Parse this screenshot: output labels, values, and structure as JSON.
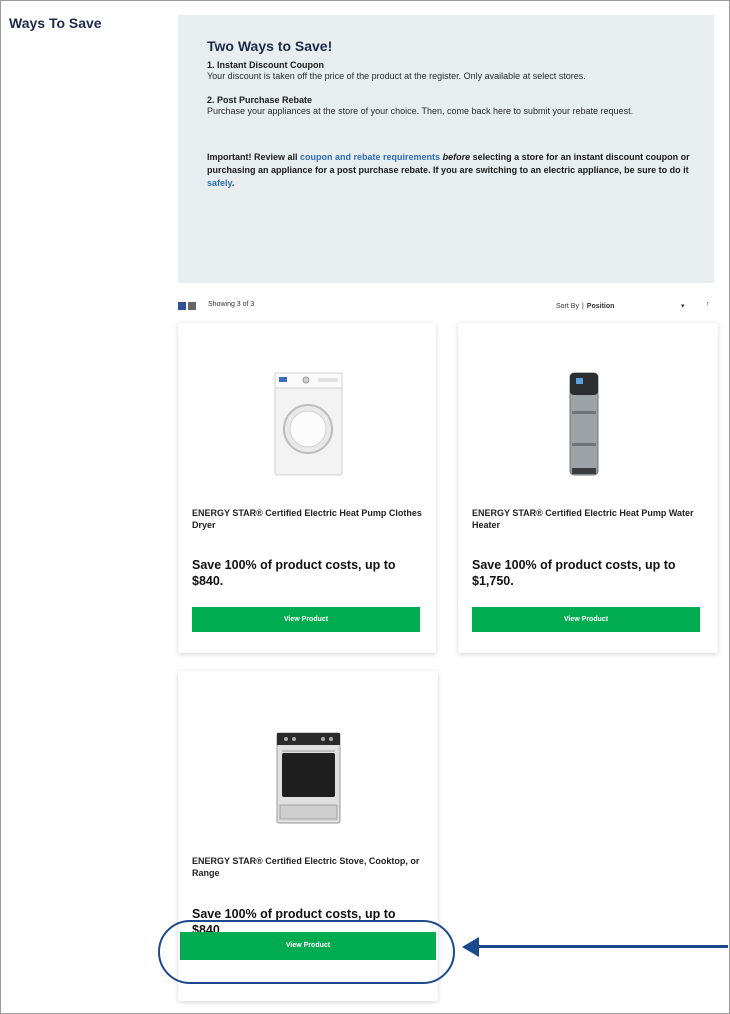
{
  "sidebar": {
    "title": "Ways To Save"
  },
  "info": {
    "title": "Two Ways to Save!",
    "option1_title": "1. Instant Discount Coupon",
    "option1_text": "Your discount is taken off the price of the product at the register. Only available at select stores.",
    "option2_title": "2. Post Purchase Rebate",
    "option2_text": "Purchase your appliances at the store of your choice. Then, come back here to submit your rebate request.",
    "important_prefix": "Important! Review all ",
    "important_link": "coupon and rebate requirements",
    "important_before": "before",
    "important_mid": " selecting a store for an instant discount coupon or purchasing an appliance for a post purchase rebate. If you are switching to an electric appliance, be sure to do it ",
    "important_link2": "safely",
    "important_end": "."
  },
  "toolbar": {
    "showing": "Showing 3 of 3",
    "sort_label": "Sort By",
    "sort_separator": "|",
    "sort_value": "Position",
    "sort_chevron": "▾",
    "sort_direction_icon": "↑"
  },
  "products": [
    {
      "name": "ENERGY STAR® Certified Electric Heat Pump Clothes Dryer",
      "save": "Save 100% of product costs, up to $840.",
      "button": "View Product",
      "icon": "clothes-dryer-image"
    },
    {
      "name": "ENERGY STAR® Certified Electric Heat Pump Water Heater",
      "save": "Save 100% of product costs, up to $1,750.",
      "button": "View Product",
      "icon": "water-heater-image"
    },
    {
      "name": "ENERGY STAR® Certified Electric Stove, Cooktop, or Range",
      "save": "Save 100% of product costs, up to $840.",
      "button": "View Product",
      "icon": "electric-range-image"
    }
  ],
  "colors": {
    "accent_green": "#00ac4f",
    "annotation_blue": "#1b4a8c",
    "info_bg": "#e8eef0",
    "link_blue": "#2f6fb5"
  }
}
